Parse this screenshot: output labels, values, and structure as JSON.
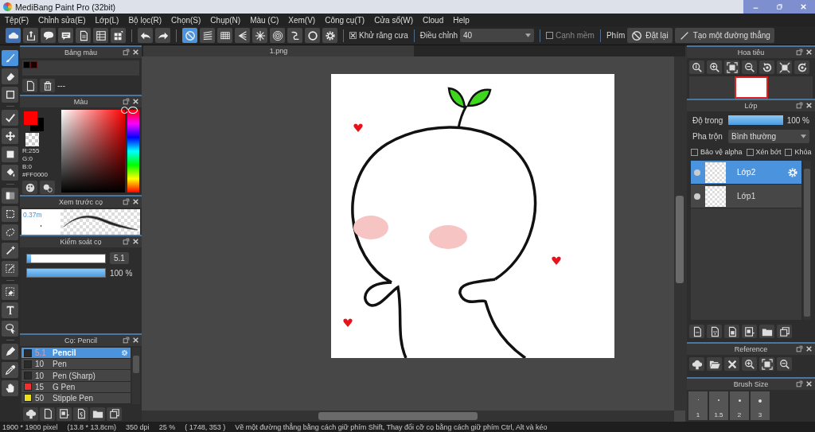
{
  "window": {
    "title": "MediBang Paint Pro (32bit)"
  },
  "menu": [
    "Tệp(F)",
    "Chỉnh sửa(E)",
    "Lớp(L)",
    "Bộ lọc(R)",
    "Chọn(S)",
    "Chụp(N)",
    "Màu (C)",
    "Xem(V)",
    "Công cụ(T)",
    "Cửa sổ(W)",
    "Cloud",
    "Help"
  ],
  "toolbar": {
    "snaps": [
      {
        "selected": true
      },
      {
        "selected": false
      },
      {
        "selected": false
      },
      {
        "selected": false
      },
      {
        "selected": false
      },
      {
        "selected": false
      },
      {
        "selected": false
      },
      {
        "selected": false
      },
      {
        "selected": false
      }
    ],
    "antialias": {
      "label": "Khử răng cưa",
      "checked": true
    },
    "correction": {
      "label": "Điều chỉnh",
      "value": "40"
    },
    "soft_edge": {
      "label": "Cạnh mềm",
      "checked": false
    },
    "keys_label": "Phím",
    "buttons": [
      "Đặt lại",
      "Tạo một đường thẳng"
    ]
  },
  "tools": [
    {
      "selected": true
    },
    {
      "selected": false
    },
    {
      "selected": false
    },
    {
      "selected": false
    },
    {
      "selected": false
    },
    {
      "selected": false
    },
    {
      "selected": false
    },
    {
      "selected": false
    },
    {
      "selected": false
    },
    {
      "selected": false
    },
    {
      "selected": false
    },
    {
      "selected": false
    },
    {
      "selected": false
    },
    {
      "selected": false
    },
    {
      "selected": false
    },
    {
      "selected": false
    },
    {
      "selected": false
    },
    {
      "selected": false
    }
  ],
  "palette_panel": {
    "title": "Bảng màu",
    "swatches": [
      {
        "color": "#000000"
      },
      {
        "color": "#1c0000"
      }
    ],
    "label": "---"
  },
  "color_panel": {
    "title": "Màu",
    "colors": [
      {
        "color": "#ff0000"
      },
      {
        "color": "#000000"
      }
    ],
    "readout": [
      "R:255",
      "G:0",
      "B:0",
      "#FF0000"
    ]
  },
  "brush_preview": {
    "title": "Xem trước cọ",
    "size": "0.37m"
  },
  "brush_control": {
    "title": "Kiểm soát cọ",
    "size": {
      "level": 0.05,
      "value": "5.1"
    },
    "opacity": {
      "level": 1,
      "value": "100 %"
    }
  },
  "brushes": {
    "title": "Cọ: Pencil",
    "items": [
      {
        "size": "5.1",
        "name": "Pencil",
        "color": "#2a2a2a",
        "selected": true
      },
      {
        "size": "10",
        "name": "Pen",
        "color": "#2a2a2a",
        "selected": false
      },
      {
        "size": "10",
        "name": "Pen (Sharp)",
        "color": "#2a2a2a",
        "selected": false
      },
      {
        "size": "15",
        "name": "G Pen",
        "color": "#f03030",
        "selected": false
      },
      {
        "size": "50",
        "name": "Stipple Pen",
        "color": "#e8e020",
        "selected": false
      }
    ]
  },
  "document_tab": "1.png",
  "navigator": {
    "title": "Hoa tiêu"
  },
  "layers": {
    "title": "Lớp",
    "opacity": {
      "label": "Độ trong",
      "level": 1,
      "value": "100 %"
    },
    "blend": {
      "label": "Pha trộn",
      "value": "Bình thường"
    },
    "options": [
      {
        "label": "Bảo vệ alpha",
        "checked": false
      },
      {
        "label": "Xén bớt",
        "checked": false
      },
      {
        "label": "Khóa",
        "checked": false
      }
    ],
    "items": [
      {
        "name": "Lớp2",
        "selected": true
      },
      {
        "name": "Lớp1",
        "selected": false
      }
    ]
  },
  "reference": {
    "title": "Reference"
  },
  "brush_size": {
    "title": "Brush Size",
    "sizes": [
      "1",
      "1.5",
      "2",
      "3"
    ]
  },
  "status_bar": {
    "dimensions": "1900 * 1900 pixel",
    "physical": "(13.8 * 13.8cm)",
    "dpi": "350 dpi",
    "zoom": "25 %",
    "cursor": "( 1748, 353 )",
    "hint": "Vẽ một đường thẳng bằng cách giữ phím Shift, Thay đổi cỡ cọ bằng cách giữ phím Ctrl, Alt và kéo"
  }
}
